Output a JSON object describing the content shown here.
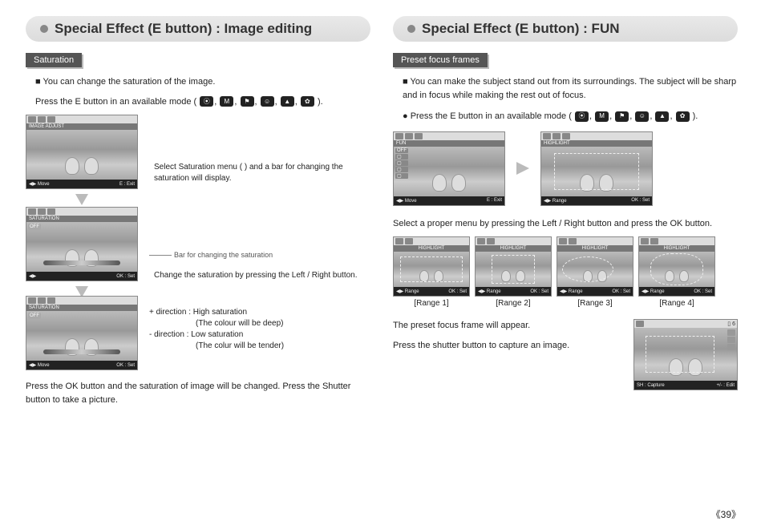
{
  "left": {
    "title": "Special Effect (E button) : Image editing",
    "sub": "Saturation",
    "p1": "You can change the saturation of the image.",
    "p2a": "Press the E button in an available mode (",
    "p2b": ").",
    "sc1_label": "IMAGE ADJUST",
    "sc1_bot_left": "Move",
    "sc1_bot_mid": "E",
    "sc1_bot_right": "Exit",
    "cap1": "Select Saturation menu (        ) and  a bar for changing the saturation will display.",
    "sc2_label": "SATURATION",
    "sc2_off": "OFF",
    "sc2_bot_mid": "OK",
    "sc2_bot_right": "Set",
    "pointer2": "Bar for changing the saturation",
    "cap2": "Change the saturation by pressing the Left / Right button.",
    "sc3_label": "SATURATION",
    "sc3_off": "OFF",
    "sc3_bot_left": "Move",
    "sc3_bot_mid": "OK",
    "sc3_bot_right": "Set",
    "dir_plus_l": "+ direction  :",
    "dir_plus_r": "High saturation",
    "dir_plus_r2": "(The colour will be deep)",
    "dir_min_l": "- direction  :",
    "dir_min_r": "Low saturation",
    "dir_min_r2": "(The colur will be tender)",
    "p3": "Press the OK button and the saturation of image will be changed. Press the Shutter button to take a picture."
  },
  "right": {
    "title": "Special Effect (E button) : FUN",
    "sub": "Preset focus frames",
    "p1": "You can make the subject stand out from its surroundings. The subject will be sharp and in focus while making the rest out of focus.",
    "p2a": "Press the E button in an available mode (",
    "p2b": ").",
    "scL_label": "FUN",
    "scL_off": "OFF",
    "scL_bot_left": "Move",
    "scL_bot_mid": "E",
    "scL_bot_right": "Exit",
    "scR_label": "HIGHLIGHT",
    "scR_bot_left": "Range",
    "scR_bot_mid": "OK",
    "scR_bot_right": "Set",
    "p3": "Select a proper menu by pressing the Left / Right button and press the OK button.",
    "ranges": [
      {
        "label": "HIGHLIGHT",
        "bot_l": "Range",
        "bot_m": "OK",
        "bot_r": "Set",
        "cap": "[Range 1]"
      },
      {
        "label": "HIGHLIGHT",
        "bot_l": "Range",
        "bot_m": "OK",
        "bot_r": "Set",
        "cap": "[Range 2]"
      },
      {
        "label": "HIGHLIGHT",
        "bot_l": "Range",
        "bot_m": "OK",
        "bot_r": "Set",
        "cap": "[Range 3]"
      },
      {
        "label": "HIGHLIGHT",
        "bot_l": "Range",
        "bot_m": "OK",
        "bot_r": "Set",
        "cap": "[Range 4]"
      }
    ],
    "p4": "The preset focus frame will appear.",
    "p5": "Press the shutter button to capture an image.",
    "scF_count": "6",
    "scF_bot_l": "SH",
    "scF_bot_m": "Capture",
    "scF_bot_r": "+/-",
    "scF_bot_r2": "Edit"
  },
  "modes": [
    "⦿",
    "M",
    "⚑",
    "☺",
    "▲",
    "✿"
  ],
  "page": "《39》"
}
